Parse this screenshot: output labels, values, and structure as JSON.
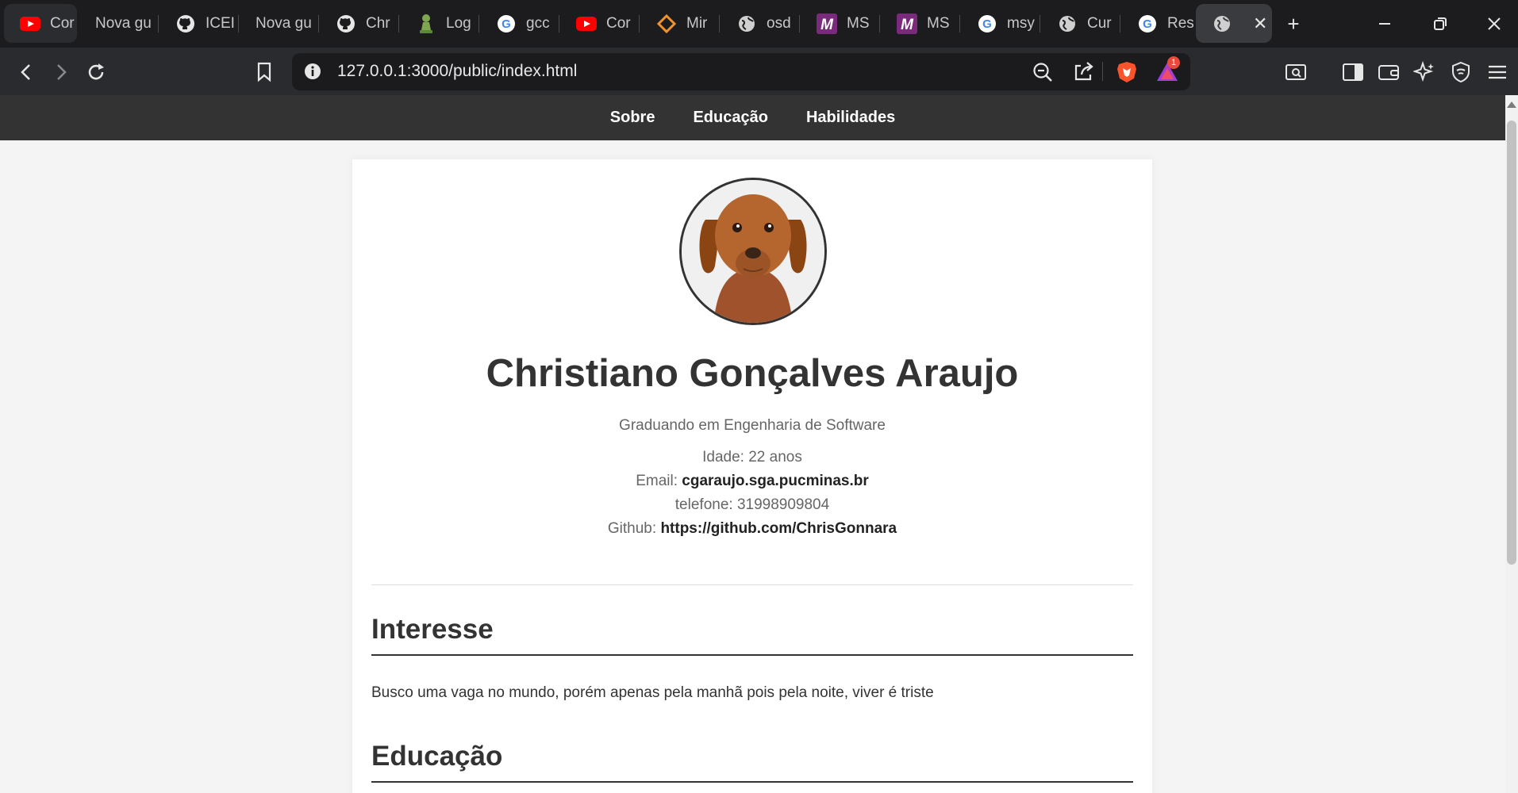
{
  "browser": {
    "tabs": [
      {
        "title": "Cor",
        "icon": "youtube-icon"
      },
      {
        "title": "Nova gu",
        "icon": "none"
      },
      {
        "title": "ICEI",
        "icon": "github-icon"
      },
      {
        "title": "Nova gu",
        "icon": "none"
      },
      {
        "title": "Chr",
        "icon": "github-icon"
      },
      {
        "title": "Log",
        "icon": "chess-pawn-icon"
      },
      {
        "title": "gcc",
        "icon": "google-icon"
      },
      {
        "title": "Cor",
        "icon": "youtube-icon"
      },
      {
        "title": "Mir",
        "icon": "diamond-icon"
      },
      {
        "title": "osd",
        "icon": "globe-icon"
      },
      {
        "title": "MS",
        "icon": "m-logo-icon"
      },
      {
        "title": "MS",
        "icon": "m-logo-icon"
      },
      {
        "title": "msy",
        "icon": "google-icon"
      },
      {
        "title": "Cur",
        "icon": "globe-icon"
      },
      {
        "title": "Res",
        "icon": "google-icon"
      }
    ],
    "url": "127.0.0.1:3000/public/index.html",
    "notification_count": "1",
    "colors": {
      "youtube": "#ff0000",
      "brave": "#fb542b",
      "badge": "#e84a3c"
    }
  },
  "site": {
    "nav": [
      "Sobre",
      "Educação",
      "Habilidades"
    ],
    "profile": {
      "name": "Christiano Gonçalves Araujo",
      "subtitle": "Graduando em Engenharia de Software",
      "age": "Idade: 22 anos",
      "email_label": "Email:",
      "email_value": "cgaraujo.sga.pucminas.br",
      "phone": "telefone: 31998909804",
      "github_label": "Github:",
      "github_value": "https://github.com/ChrisGonnara"
    },
    "sections": {
      "interest_title": "Interesse",
      "interest_text": "Busco uma vaga no mundo, porém apenas pela manhã pois pela noite, viver é triste",
      "education_title": "Educação"
    }
  }
}
